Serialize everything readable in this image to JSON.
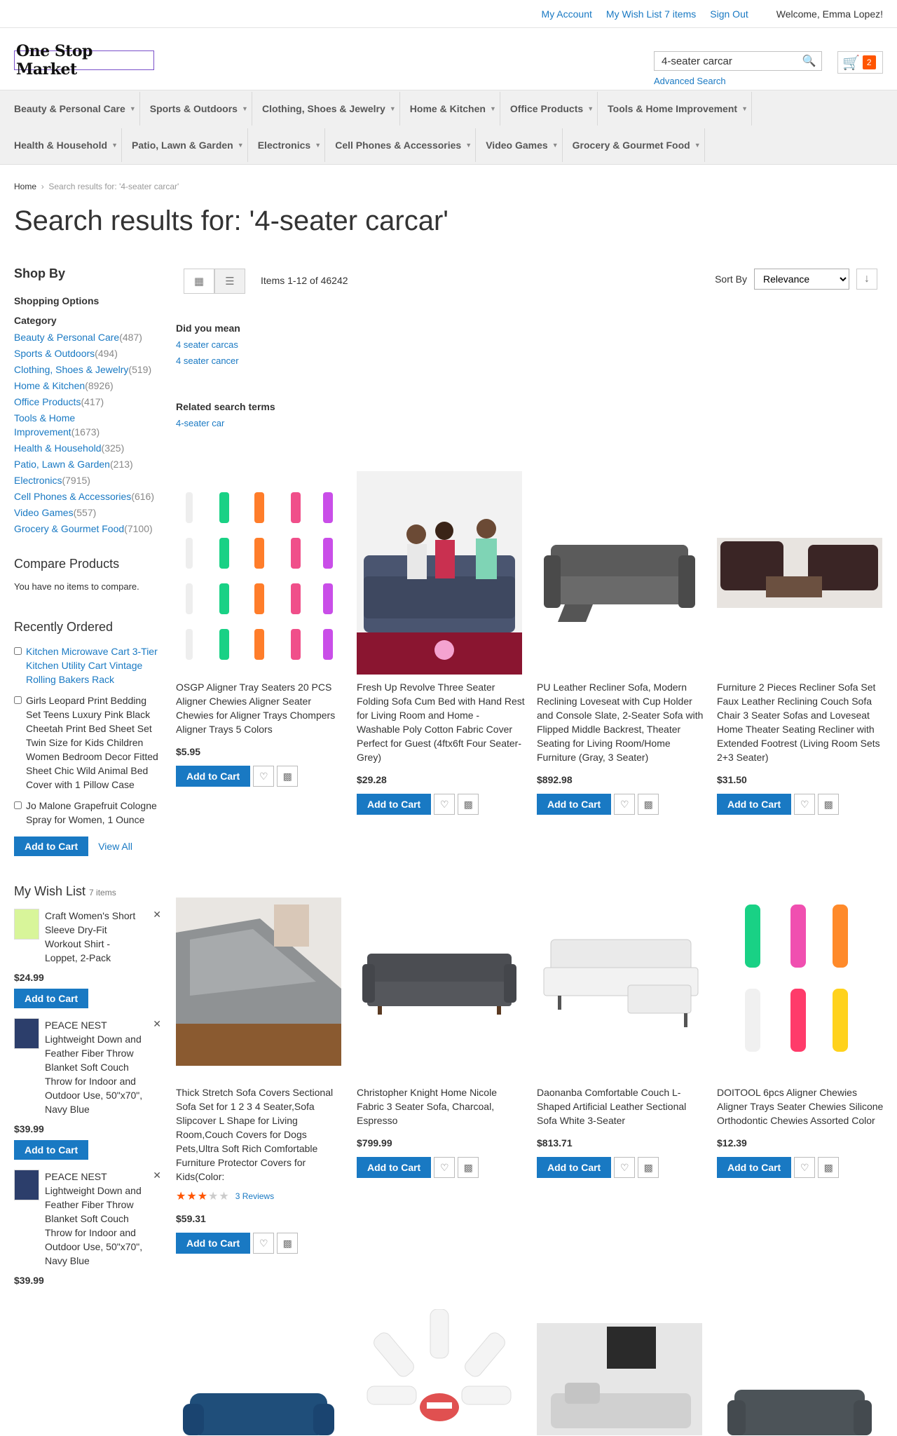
{
  "header": {
    "links": [
      "My Account",
      "My Wish List 7 items",
      "Sign Out"
    ],
    "welcome": "Welcome, Emma Lopez!",
    "logo": "One Stop Market",
    "search_value": "4-seater carcar",
    "advanced_search": "Advanced Search",
    "cart_count": "2"
  },
  "nav": {
    "row1": [
      "Beauty & Personal Care",
      "Sports & Outdoors",
      "Clothing, Shoes & Jewelry",
      "Home & Kitchen",
      "Office Products",
      "Tools & Home Improvement"
    ],
    "row2": [
      "Health & Household",
      "Patio, Lawn & Garden",
      "Electronics",
      "Cell Phones & Accessories",
      "Video Games",
      "Grocery & Gourmet Food"
    ]
  },
  "breadcrumb": {
    "home": "Home",
    "current": "Search results for: '4-seater carcar'"
  },
  "page_title": "Search results for: '4-seater carcar'",
  "sidebar": {
    "shop_by": "Shop By",
    "shopping_options": "Shopping Options",
    "category_label": "Category",
    "categories": [
      {
        "name": "Beauty & Personal Care",
        "count": "487"
      },
      {
        "name": "Sports & Outdoors",
        "count": "494"
      },
      {
        "name": "Clothing, Shoes & Jewelry",
        "count": "519"
      },
      {
        "name": "Home & Kitchen",
        "count": "8926"
      },
      {
        "name": "Office Products",
        "count": "417"
      },
      {
        "name": "Tools & Home Improvement",
        "count": "1673"
      },
      {
        "name": "Health & Household",
        "count": "325"
      },
      {
        "name": "Patio, Lawn & Garden",
        "count": "213"
      },
      {
        "name": "Electronics",
        "count": "7915"
      },
      {
        "name": "Cell Phones & Accessories",
        "count": "616"
      },
      {
        "name": "Video Games",
        "count": "557"
      },
      {
        "name": "Grocery & Gourmet Food",
        "count": "7100"
      }
    ],
    "compare_title": "Compare Products",
    "compare_empty": "You have no items to compare.",
    "recent_title": "Recently Ordered",
    "recent_items": [
      "Kitchen Microwave Cart 3-Tier Kitchen Utility Cart Vintage Rolling Bakers Rack",
      "Girls Leopard Print Bedding Set Teens Luxury Pink Black Cheetah Print Bed Sheet Set Twin Size for Kids Children Women Bedroom Decor Fitted Sheet Chic Wild Animal Bed Cover with 1 Pillow Case",
      "Jo Malone Grapefruit Cologne Spray for Women, 1 Ounce"
    ],
    "add_to_cart": "Add to Cart",
    "view_all": "View All",
    "wishlist_title": "My Wish List",
    "wishlist_count": "7 items",
    "wishlist_items": [
      {
        "name": "Craft Women's Short Sleeve Dry-Fit Workout Shirt - Loppet, 2-Pack",
        "price": "$24.99"
      },
      {
        "name": "PEACE NEST Lightweight Down and Feather Fiber Throw Blanket Soft Couch Throw for Indoor and Outdoor Use, 50\"x70\", Navy Blue",
        "price": "$39.99"
      },
      {
        "name": "PEACE NEST Lightweight Down and Feather Fiber Throw Blanket Soft Couch Throw for Indoor and Outdoor Use, 50\"x70\", Navy Blue",
        "price": "$39.99"
      }
    ]
  },
  "toolbar": {
    "amount": "Items 1-12 of 46242",
    "sort_by": "Sort By",
    "sort_value": "Relevance"
  },
  "suggestions": {
    "did_you_mean": "Did you mean",
    "dym_items": [
      "4 seater carcas",
      "4 seater cancer"
    ],
    "related": "Related search terms",
    "related_items": [
      "4-seater car"
    ]
  },
  "products": [
    {
      "name": "OSGP Aligner Tray Seaters 20 PCS Aligner Chewies Aligner Seater Chewies for Aligner Trays Chompers Aligner Trays 5 Colors",
      "price": "$5.95"
    },
    {
      "name": "Fresh Up Revolve Three Seater Folding Sofa Cum Bed with Hand Rest for Living Room and Home - Washable Poly Cotton Fabric Cover Perfect for Guest (4ftx6ft Four Seater- Grey)",
      "price": "$29.28"
    },
    {
      "name": "PU Leather Recliner Sofa, Modern Reclining Loveseat with Cup Holder and Console Slate, 2-Seater Sofa with Flipped Middle Backrest, Theater Seating for Living Room/Home Furniture (Gray, 3 Seater)",
      "price": "$892.98"
    },
    {
      "name": "Furniture 2 Pieces Recliner Sofa Set Faux Leather Reclining Couch Sofa Chair 3 Seater Sofas and Loveseat Home Theater Seating Recliner with Extended Footrest (Living Room Sets 2+3 Seater)",
      "price": "$31.50"
    },
    {
      "name": "Thick Stretch Sofa Covers Sectional Sofa Set for 1 2 3 4 Seater,Sofa Slipcover L Shape for Living Room,Couch Covers for Dogs Pets,Ultra Soft Rich Comfortable Furniture Protector Covers for Kids(Color:",
      "price": "$59.31",
      "reviews": "3 Reviews",
      "rating": 3
    },
    {
      "name": "Christopher Knight Home Nicole Fabric 3 Seater Sofa, Charcoal, Espresso",
      "price": "$799.99"
    },
    {
      "name": "Daonanba Comfortable Couch L-Shaped Artificial Leather Sectional Sofa White 3-Seater",
      "price": "$813.71"
    },
    {
      "name": "DOITOOL 6pcs Aligner Chewies Aligner Trays Seater Chewies Silicone Orthodontic Chewies Assorted Color",
      "price": "$12.39"
    }
  ],
  "colors": {
    "accent": "#1979c3",
    "cart_badge": "#ff5501"
  }
}
